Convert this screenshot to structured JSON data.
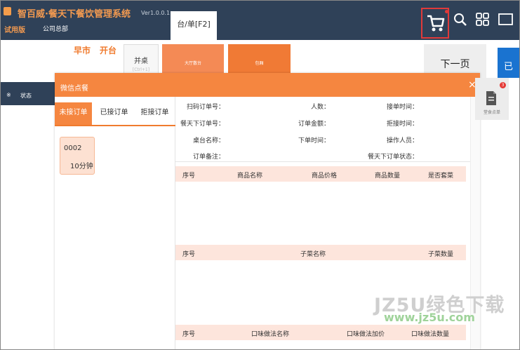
{
  "app": {
    "title": "智百威·餐天下餐饮管理系统",
    "version": "Ver1.0.0.1",
    "edition": "试用版",
    "company": "公司总部",
    "active_tab": "台/单[F2]",
    "cart_icon": "shopping-cart-icon",
    "accent": "#f58640",
    "header_bg": "#2f4158"
  },
  "toolbar": {
    "icons": [
      "search-icon",
      "grid-icon",
      "window-icon"
    ]
  },
  "tables_area": {
    "period": "早市",
    "open_table": "开台",
    "tile_merge": "并桌",
    "tile_merge_sub": "[Ctrl+1]",
    "tile_hall": "大厅散台",
    "tile_room": "包厢",
    "next_page": "下一页",
    "blue_button": "已",
    "status_col_prefix": "※",
    "status_col": "状态"
  },
  "side_widget": {
    "badge": "3",
    "label": "堂食点单"
  },
  "modal": {
    "title": "微信点餐",
    "close": "×",
    "tabs": [
      "未接订单",
      "已接订单",
      "拒接订单"
    ],
    "orders": [
      {
        "table": "0002",
        "time": "10分钟"
      }
    ],
    "fields": {
      "scan_order_no": "扫码订单号：",
      "people": "人数：",
      "accept_time": "接单时间：",
      "ctx_order_no": "餐天下订单号：",
      "order_amount": "订单金额：",
      "reject_time": "拒接时间：",
      "table_name": "桌台名称：",
      "order_time": "下单时间：",
      "operator": "操作人员：",
      "order_note": "订单备注：",
      "ctx_order_status": "餐天下订单状态："
    },
    "items_table": [
      "序号",
      "商品名称",
      "商品价格",
      "商品数量",
      "是否套菜"
    ],
    "sub_table": [
      "序号",
      "子菜名称",
      "子菜数量"
    ],
    "flavor_table": [
      "序号",
      "口味做法名称",
      "口味做法加价",
      "口味做法数量"
    ]
  },
  "watermark": {
    "text": "JZ5U绿色下载",
    "url": "www.jz5u.com"
  }
}
